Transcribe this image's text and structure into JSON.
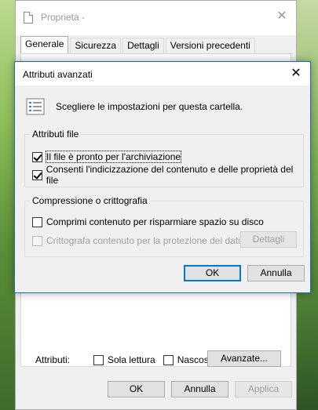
{
  "properties": {
    "title": "Proprietà -",
    "tabs": [
      "Generale",
      "Sicurezza",
      "Dettagli",
      "Versioni precedenti"
    ],
    "attributes_label": "Attributi:",
    "readonly_label": "Sola lettura",
    "hidden_label": "Nascosto",
    "advanced_button": "Avanzate...",
    "ok": "OK",
    "cancel": "Annulla",
    "apply": "Applica"
  },
  "advanced_dialog": {
    "title": "Attributi avanzati",
    "header_text": "Scegliere le impostazioni per questa cartella.",
    "file_attributes": {
      "group_title": "Attributi file",
      "archive_label": "Il file è pronto per l'archiviazione",
      "archive_checked": true,
      "index_label": "Consenti l'indicizzazione del contenuto e delle proprietà del file",
      "index_checked": true
    },
    "compression": {
      "group_title": "Compressione o crittografia",
      "compress_label": "Comprimi contenuto per risparmiare spazio su disco",
      "compress_checked": false,
      "encrypt_label": "Crittografa contenuto per la protezione dei dati",
      "encrypt_checked": false,
      "encrypt_enabled": false,
      "details_button": "Dettagli"
    },
    "ok": "OK",
    "cancel": "Annulla"
  },
  "colors": {
    "focus_blue": "#0078d7",
    "dialog_border": "#1b6bb5",
    "dialog_bg": "#f0f0f0"
  }
}
